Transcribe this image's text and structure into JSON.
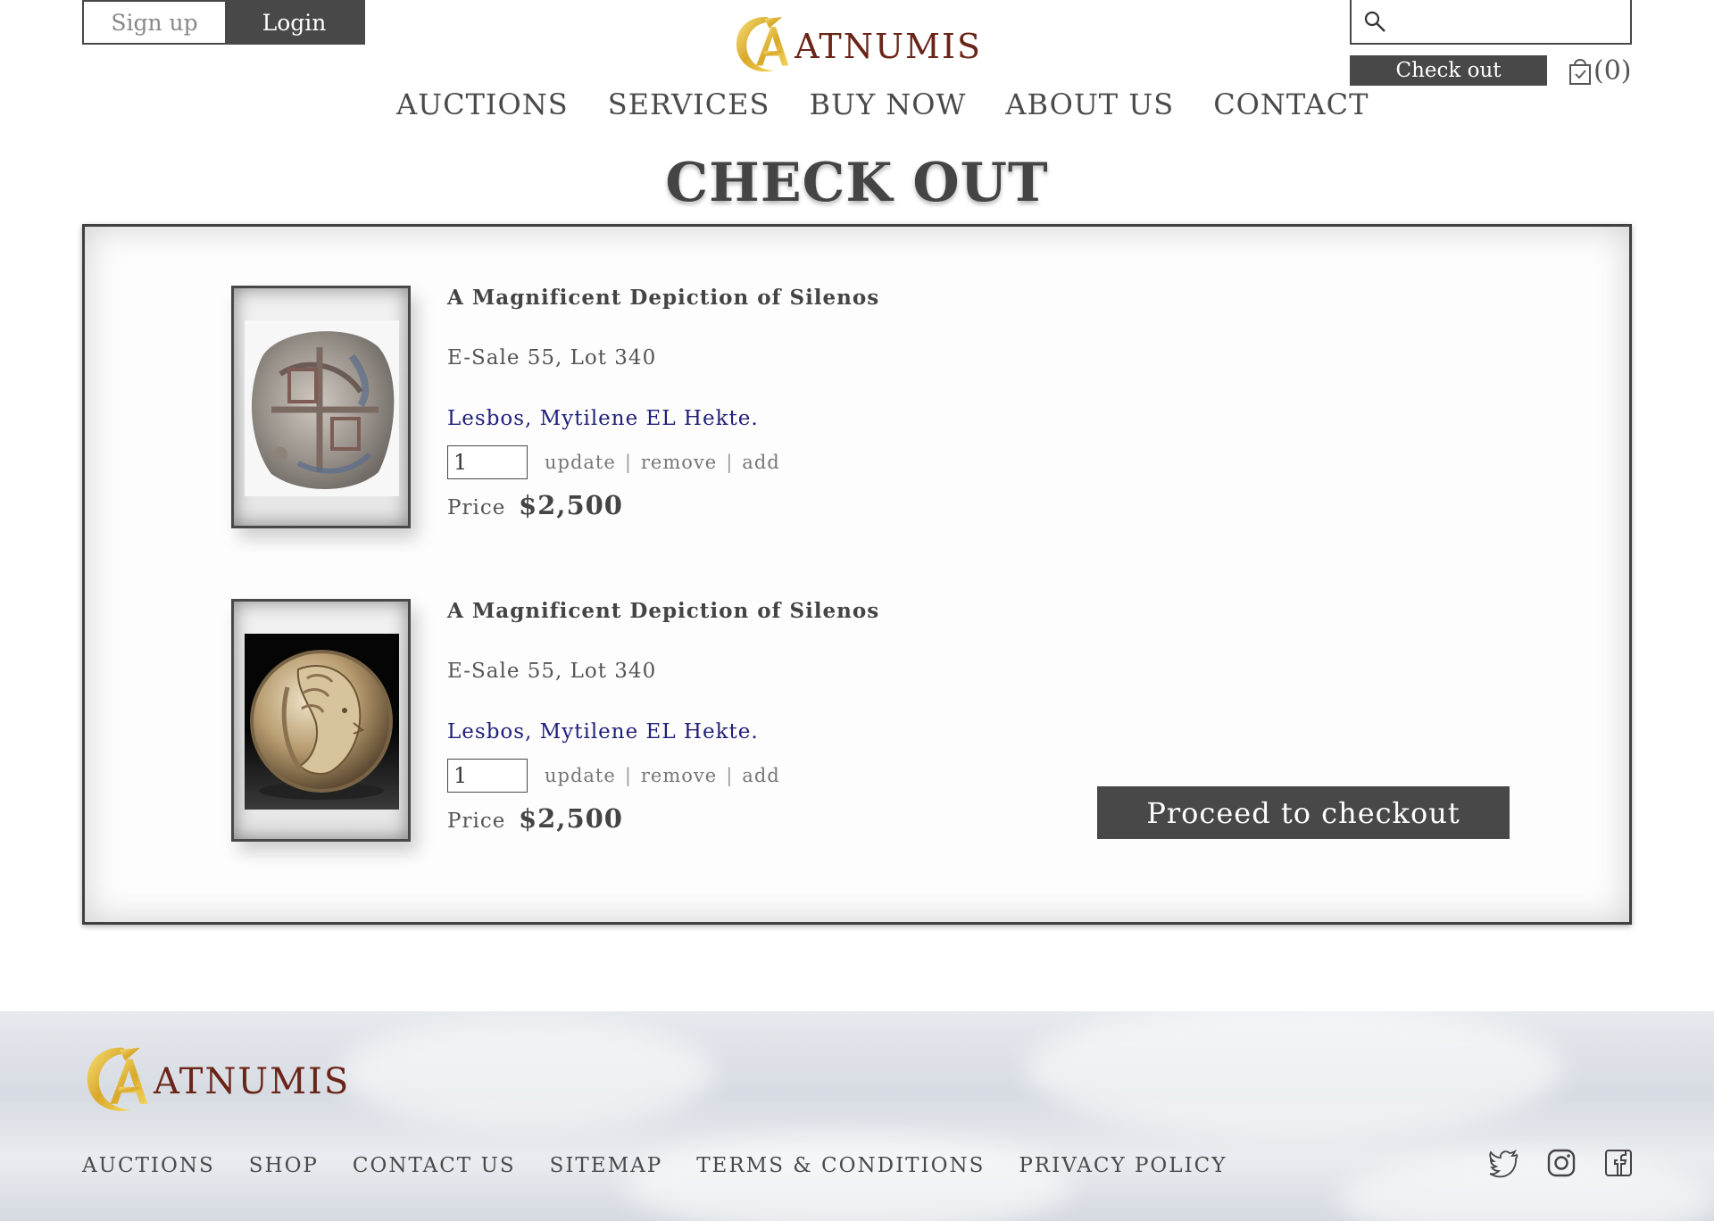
{
  "header": {
    "signup_label": "Sign up",
    "login_label": "Login",
    "brand": "ATNUMIS",
    "search_placeholder": "",
    "checkout_label": "Check out",
    "cart_count": "(0)"
  },
  "nav": [
    "AUCTIONS",
    "SERVICES",
    "BUY NOW",
    "ABOUT US",
    "CONTACT"
  ],
  "page_title": "CHECK OUT",
  "cart_items": [
    {
      "name": "A Magnificent Depiction of Silenos",
      "lot": "E-Sale 55, Lot 340",
      "link": "Lesbos, Mytilene EL Hekte.",
      "quantity": "1",
      "update_label": "update",
      "remove_label": "remove",
      "add_label": "add",
      "price_label": "Price",
      "price": "$2,500",
      "image": "silver-cob-coin"
    },
    {
      "name": "A Magnificent Depiction of Silenos",
      "lot": "E-Sale 55, Lot 340",
      "link": "Lesbos, Mytilene EL Hekte.",
      "quantity": "1",
      "update_label": "update",
      "remove_label": "remove",
      "add_label": "add",
      "price_label": "Price",
      "price": "$2,500",
      "image": "herakles-head-coin"
    }
  ],
  "proceed_label": "Proceed to checkout",
  "footer": {
    "brand": "ATNUMIS",
    "links": [
      "AUCTIONS",
      "SHOP",
      "CONTACT US",
      "SITEMAP",
      "TERMS & CONDITIONS",
      "PRIVACY POLICY"
    ],
    "social": [
      "twitter-icon",
      "instagram-icon",
      "facebook-icon"
    ]
  },
  "colors": {
    "dark": "#484848",
    "brand_red": "#6b2418",
    "gold": "#d4a92c",
    "link_blue": "#1f1f7a"
  }
}
